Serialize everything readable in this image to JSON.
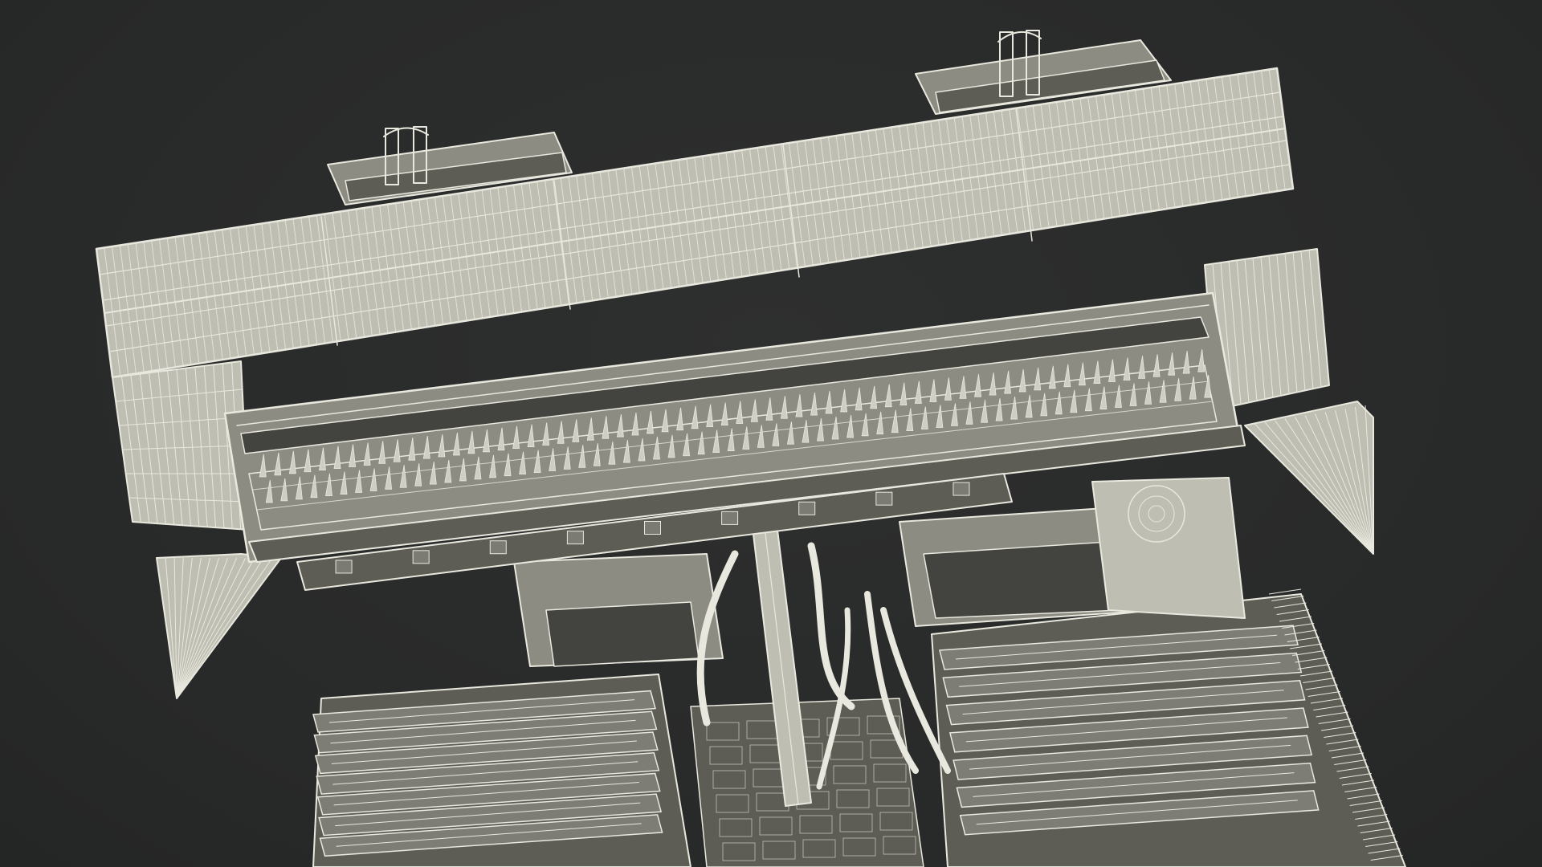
{
  "scene": {
    "subject_icon": "combine-harvester-header-wireframe",
    "background_color": "#2a2b2b",
    "wire_color": "#e9e8de",
    "surface_color": "#8d8c82",
    "auger_tooth_count": 64,
    "header_slat_count": 150,
    "track_link_count": 7
  }
}
